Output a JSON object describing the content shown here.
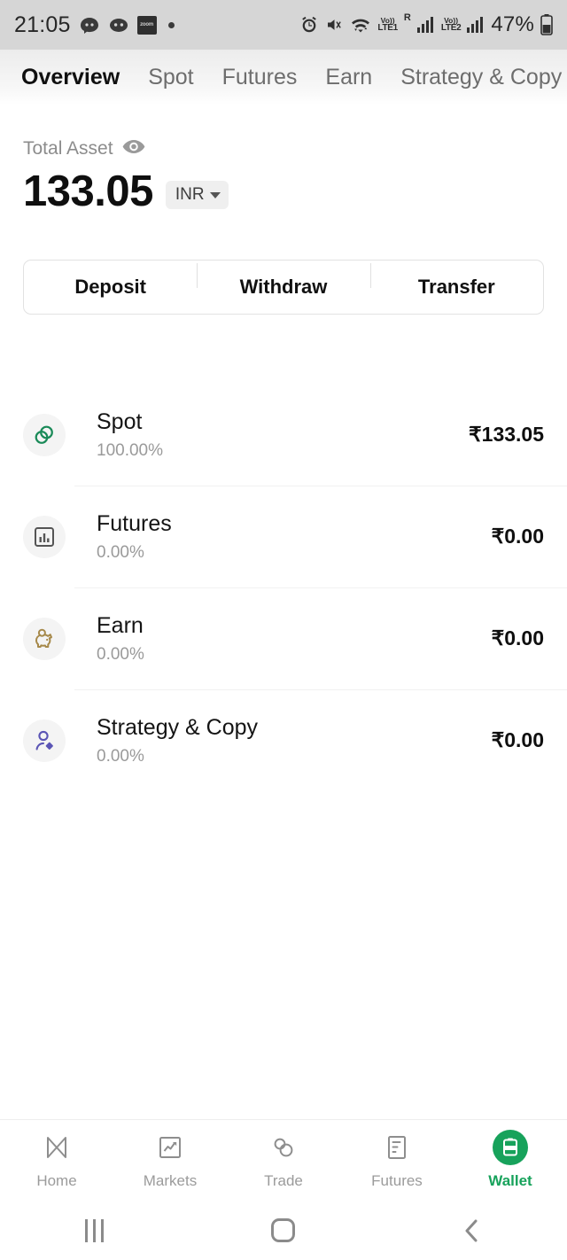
{
  "status_bar": {
    "time": "21:05",
    "app_badge_text": "zoom",
    "battery_percent": "47%",
    "sim1_volte": "Vo))",
    "sim1_network": "LTE1",
    "roaming": "R",
    "sim2_volte": "Vo))",
    "sim2_network": "LTE2",
    "icons": [
      "discord-icon",
      "discord-icon",
      "app-badge-icon",
      "dot-icon",
      "alarm-icon",
      "mute-icon",
      "wifi-icon",
      "signal-icon",
      "battery-icon"
    ]
  },
  "tabs": [
    {
      "label": "Overview",
      "active": true
    },
    {
      "label": "Spot",
      "active": false
    },
    {
      "label": "Futures",
      "active": false
    },
    {
      "label": "Earn",
      "active": false
    },
    {
      "label": "Strategy & Copy",
      "active": false
    }
  ],
  "total_asset": {
    "label": "Total Asset",
    "eye_icon": "eye-icon",
    "amount": "133.05",
    "currency": "INR"
  },
  "actions": [
    {
      "label": "Deposit"
    },
    {
      "label": "Withdraw"
    },
    {
      "label": "Transfer"
    }
  ],
  "accounts": [
    {
      "name": "Spot",
      "percent": "100.00%",
      "value": "₹133.05",
      "icon": "coins-icon",
      "color": "#1a8a58"
    },
    {
      "name": "Futures",
      "percent": "0.00%",
      "value": "₹0.00",
      "icon": "bar-chart-icon",
      "color": "#555555"
    },
    {
      "name": "Earn",
      "percent": "0.00%",
      "value": "₹0.00",
      "icon": "piggy-bank-icon",
      "color": "#a6894a"
    },
    {
      "name": "Strategy & Copy",
      "percent": "0.00%",
      "value": "₹0.00",
      "icon": "person-diamond-icon",
      "color": "#5b55b5"
    }
  ],
  "bottom_nav": [
    {
      "label": "Home",
      "icon": "home-icon",
      "active": false
    },
    {
      "label": "Markets",
      "icon": "markets-chart-icon",
      "active": false
    },
    {
      "label": "Trade",
      "icon": "trade-circles-icon",
      "active": false
    },
    {
      "label": "Futures",
      "icon": "futures-doc-icon",
      "active": false
    },
    {
      "label": "Wallet",
      "icon": "wallet-icon",
      "active": true
    }
  ],
  "android_nav": {
    "recents": "recents-icon",
    "home": "home-square-icon",
    "back": "back-chevron-icon"
  },
  "theme": {
    "accent": "#17a25b",
    "background": "#ffffff",
    "statusbar_bg": "#d6d6d6"
  }
}
